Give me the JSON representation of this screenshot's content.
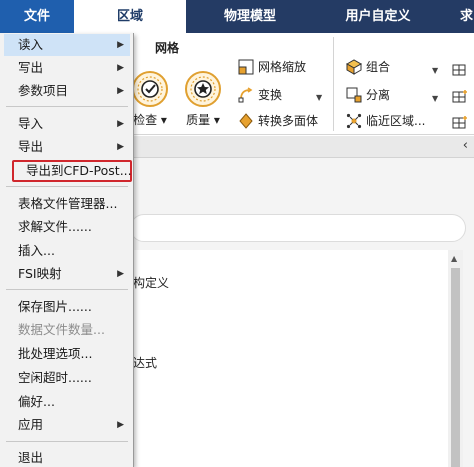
{
  "menubar": {
    "tabs": [
      "文件",
      "区域",
      "物理模型",
      "用户自定义",
      "求"
    ]
  },
  "ribbon": {
    "group_mesh_title": "网格",
    "check_label": "检查",
    "quality_label": "质量",
    "mesh_scale_label": "网格缩放",
    "transform_label": "变换",
    "convert_poly_label": "转换多面体",
    "combine_label": "组合",
    "separate_label": "分离",
    "nearby_zone_label": "临近区域..."
  },
  "panel": {
    "collapse_glyph": "‹",
    "tree_item_1": "构定义",
    "tree_item_2": "达式"
  },
  "file_menu": {
    "items": [
      {
        "label": "读入",
        "has_submenu": true,
        "state": "hover"
      },
      {
        "label": "写出",
        "has_submenu": true
      },
      {
        "label": "参数项目",
        "has_submenu": true
      },
      {
        "label": "导入",
        "has_submenu": true
      },
      {
        "label": "导出",
        "has_submenu": true
      },
      {
        "label": "导出到CFD-Post...",
        "highlighted": true
      },
      {
        "label": "表格文件管理器..."
      },
      {
        "label": "求解文件......"
      },
      {
        "label": "插入..."
      },
      {
        "label": "FSI映射",
        "has_submenu": true
      },
      {
        "label": "保存图片......"
      },
      {
        "label": "数据文件数量...",
        "disabled": true
      },
      {
        "label": "批处理选项..."
      },
      {
        "label": "空闲超时......"
      },
      {
        "label": "偏好..."
      },
      {
        "label": "应用",
        "has_submenu": true
      },
      {
        "label": "退出"
      }
    ],
    "submenu_glyph": "▶"
  },
  "colors": {
    "menubar_bg": "#243b64",
    "file_tab_bg": "#1f5fae",
    "highlight_border": "#d0272d",
    "hover_bg": "#cfe3f7"
  }
}
